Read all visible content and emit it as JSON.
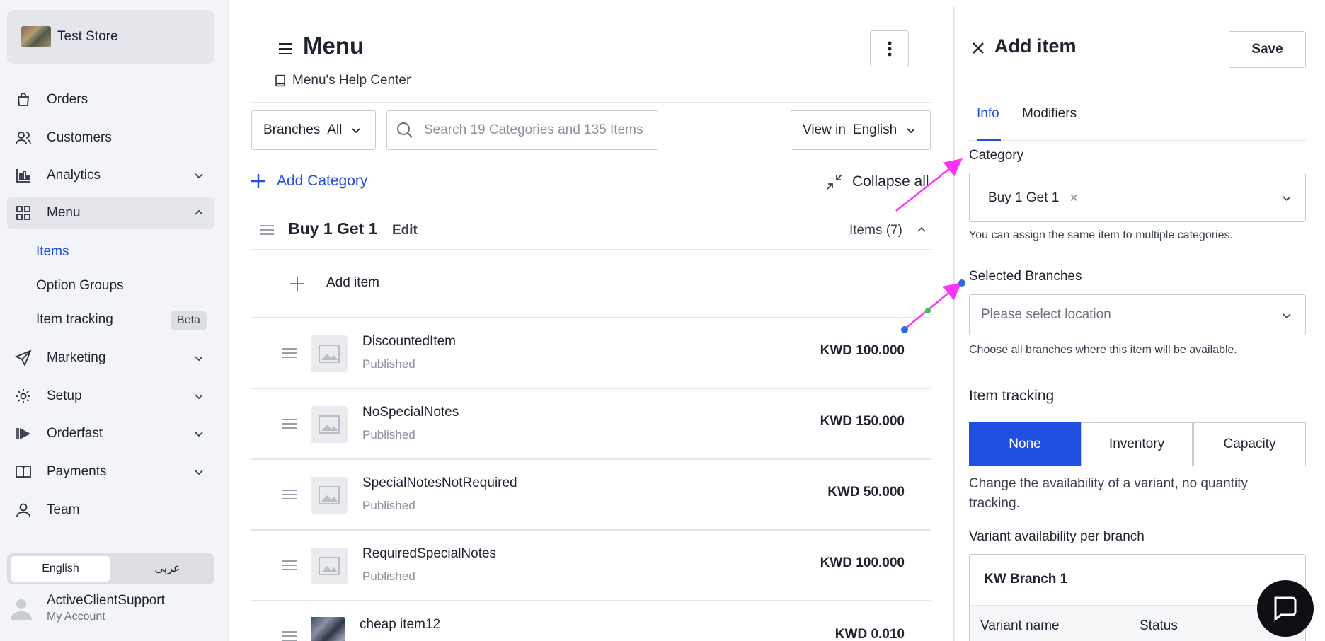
{
  "sidebar": {
    "store_name": "Test Store",
    "items": [
      {
        "label": "Orders",
        "icon": "shopping-bag-icon"
      },
      {
        "label": "Customers",
        "icon": "users-icon"
      },
      {
        "label": "Analytics",
        "icon": "bar-chart-icon"
      },
      {
        "label": "Menu",
        "icon": "grid-icon"
      },
      {
        "label": "Marketing",
        "icon": "send-icon"
      },
      {
        "label": "Setup",
        "icon": "gear-icon"
      },
      {
        "label": "Orderfast",
        "icon": "play-icon"
      },
      {
        "label": "Payments",
        "icon": "book-open-icon"
      },
      {
        "label": "Team",
        "icon": "user-icon"
      }
    ],
    "sub_items": [
      {
        "label": "Items"
      },
      {
        "label": "Option Groups"
      },
      {
        "label": "Item tracking",
        "badge": "Beta"
      }
    ],
    "language": {
      "english": "English",
      "arabic": "عربي"
    },
    "user": {
      "name": "ActiveClientSupport",
      "sub": "My Account"
    }
  },
  "main": {
    "title": "Menu",
    "help_link": "Menu's Help Center",
    "branches_filter": {
      "label": "Branches",
      "value": "All"
    },
    "search_placeholder": "Search 19 Categories and 135 Items",
    "view_in": {
      "label": "View in",
      "value": "English"
    },
    "add_category": "Add Category",
    "collapse_all": "Collapse all",
    "category": {
      "name": "Buy 1 Get 1",
      "edit": "Edit",
      "count": "Items (7)"
    },
    "add_item": "Add item",
    "items": [
      {
        "name": "DiscountedItem",
        "status": "Published",
        "price": "KWD 100.000"
      },
      {
        "name": "NoSpecialNotes",
        "status": "Published",
        "price": "KWD 150.000"
      },
      {
        "name": "SpecialNotesNotRequired",
        "status": "Published",
        "price": "KWD 50.000"
      },
      {
        "name": "RequiredSpecialNotes",
        "status": "Published",
        "price": "KWD 100.000"
      },
      {
        "name": "cheap item12",
        "status": "",
        "price": "KWD 0.010"
      }
    ]
  },
  "panel": {
    "title": "Add item",
    "save": "Save",
    "tabs": [
      "Info",
      "Modifiers"
    ],
    "category_label": "Category",
    "category_chip": "Buy 1 Get 1",
    "category_help": "You can assign the same item to multiple categories.",
    "branches_label": "Selected Branches",
    "branches_placeholder": "Please select location",
    "branches_help": "Choose all branches where this item will be available.",
    "tracking_title": "Item tracking",
    "tracking_options": [
      "None",
      "Inventory",
      "Capacity"
    ],
    "tracking_desc": "Change the availability of a variant, no quantity tracking.",
    "variant_label": "Variant availability per branch",
    "branch_name": "KW Branch 1",
    "table_headers": [
      "Variant name",
      "Status"
    ]
  },
  "colors": {
    "accent": "#1f4fe0",
    "annotation": "#ff33ff"
  }
}
